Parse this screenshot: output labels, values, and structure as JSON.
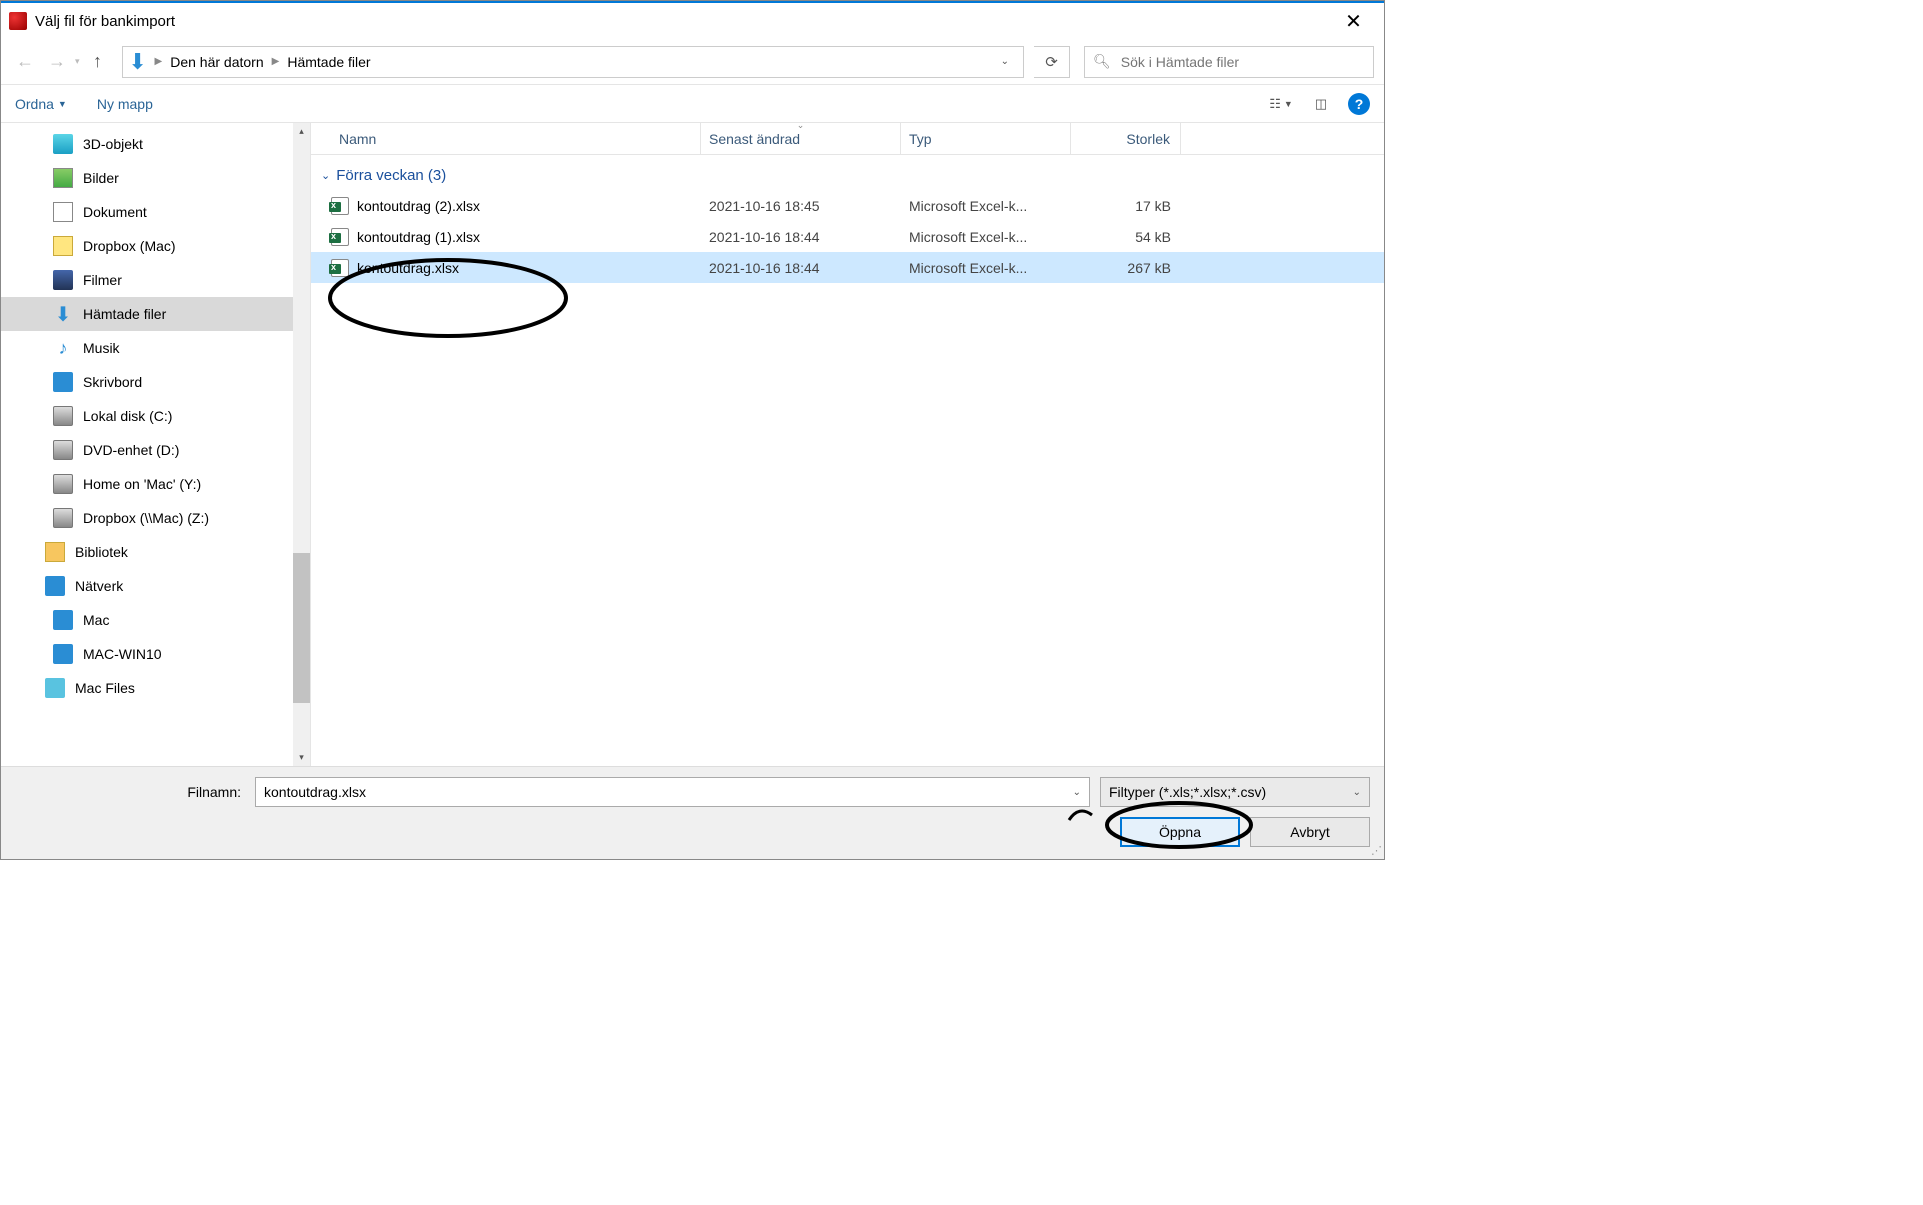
{
  "title": "Välj fil för bankimport",
  "breadcrumb": {
    "item1": "Den här datorn",
    "item2": "Hämtade filer"
  },
  "search": {
    "placeholder": "Sök i Hämtade filer"
  },
  "toolbar": {
    "organize": "Ordna",
    "newfolder": "Ny mapp"
  },
  "columns": {
    "name": "Namn",
    "date": "Senast ändrad",
    "type": "Typ",
    "size": "Storlek"
  },
  "sidebar": [
    {
      "label": "3D-objekt",
      "icon": "ic-3d"
    },
    {
      "label": "Bilder",
      "icon": "ic-img"
    },
    {
      "label": "Dokument",
      "icon": "ic-doc"
    },
    {
      "label": "Dropbox (Mac)",
      "icon": "ic-dbx"
    },
    {
      "label": "Filmer",
      "icon": "ic-film"
    },
    {
      "label": "Hämtade filer",
      "icon": "ic-dl",
      "selected": true,
      "arrow": true
    },
    {
      "label": "Musik",
      "icon": "ic-music",
      "glyph": "♪"
    },
    {
      "label": "Skrivbord",
      "icon": "ic-desk"
    },
    {
      "label": "Lokal disk (C:)",
      "icon": "ic-drive"
    },
    {
      "label": "DVD-enhet (D:)",
      "icon": "ic-drive"
    },
    {
      "label": "Home on 'Mac' (Y:)",
      "icon": "ic-drive"
    },
    {
      "label": "Dropbox (\\\\Mac) (Z:)",
      "icon": "ic-drive"
    },
    {
      "label": "Bibliotek",
      "icon": "ic-lib",
      "level": 2
    },
    {
      "label": "Nätverk",
      "icon": "ic-net",
      "level": 2
    },
    {
      "label": "Mac",
      "icon": "ic-desk"
    },
    {
      "label": "MAC-WIN10",
      "icon": "ic-desk"
    },
    {
      "label": "Mac Files",
      "icon": "ic-folder",
      "level": 2
    }
  ],
  "group": {
    "header": "Förra veckan (3)"
  },
  "files": [
    {
      "name": "kontoutdrag (2).xlsx",
      "date": "2021-10-16 18:45",
      "type": "Microsoft Excel-k...",
      "size": "17 kB"
    },
    {
      "name": "kontoutdrag (1).xlsx",
      "date": "2021-10-16 18:44",
      "type": "Microsoft Excel-k...",
      "size": "54 kB"
    },
    {
      "name": "kontoutdrag.xlsx",
      "date": "2021-10-16 18:44",
      "type": "Microsoft Excel-k...",
      "size": "267 kB",
      "selected": true
    }
  ],
  "footer": {
    "filename_label": "Filnamn:",
    "filename_value": "kontoutdrag.xlsx",
    "filetype": "Filtyper (*.xls;*.xlsx;*.csv)",
    "open": "Öppna",
    "cancel": "Avbryt"
  }
}
